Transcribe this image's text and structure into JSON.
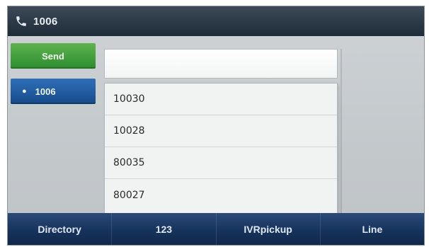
{
  "titlebar": {
    "title": "1006"
  },
  "left_buttons": {
    "send_label": "Send",
    "line_label": "1006",
    "line_bullet": "●"
  },
  "input": {
    "value": ""
  },
  "suggestions": [
    "10030",
    "10028",
    "80035",
    "80027"
  ],
  "softkeys": {
    "key1": "Directory",
    "key2": "123",
    "key3": "IVRpickup",
    "key4": "Line"
  },
  "colors": {
    "titlebar": "#1e2b38",
    "send_button": "#2d8c2f",
    "line_button": "#164b8a",
    "softkey_bar": "#17335c"
  }
}
